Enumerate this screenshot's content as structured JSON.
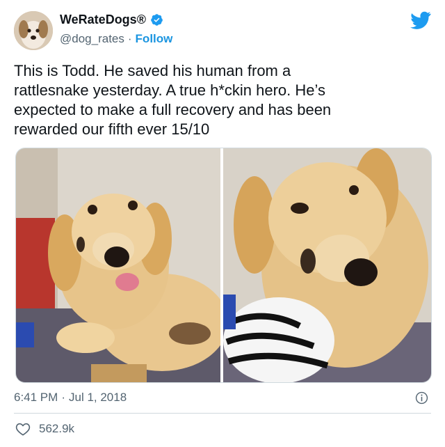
{
  "account": {
    "display_name": "WeRateDogs®",
    "handle": "@dog_rates",
    "separator": "·",
    "follow_label": "Follow",
    "verified_icon": "verified-badge-icon",
    "platform_icon": "twitter-bird-icon"
  },
  "tweet": {
    "text": "This is Todd. He saved his human from a\nrattlesnake yesterday. A true h*ckin hero. He’s\nexpected to make a full recovery and has been\nrewarded our fifth ever 15/10",
    "media_count": 2,
    "time": "6:41 PM",
    "separator": "·",
    "date": "Jul 1, 2018",
    "info_icon": "info-icon"
  },
  "engagement": {
    "like_icon": "heart-icon",
    "likes": "562.9k"
  },
  "colors": {
    "accent": "#1b95e0",
    "text": "#0f1419",
    "muted": "#536471",
    "border": "#cfd9de"
  }
}
